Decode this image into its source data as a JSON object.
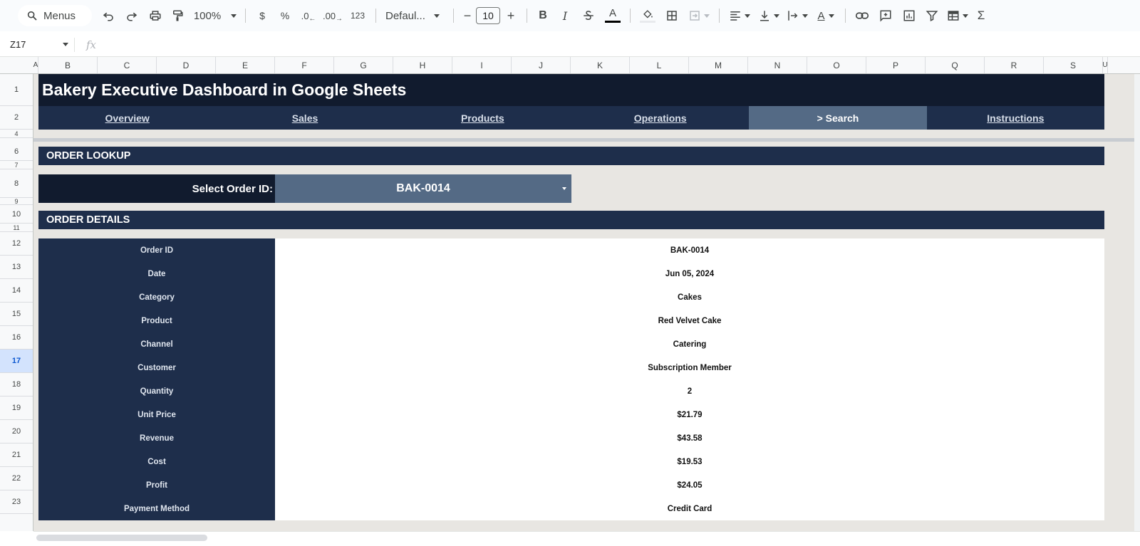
{
  "toolbar": {
    "menus_label": "Menus",
    "zoom": "100%",
    "currency": "$",
    "percent": "%",
    "dec_decrease": ".0",
    "dec_increase": ".00",
    "number_format": "123",
    "font_name": "Defaul...",
    "font_size": "10"
  },
  "formula_bar": {
    "name_box": "Z17",
    "fx": "fx"
  },
  "columns": [
    "A",
    "B",
    "C",
    "D",
    "E",
    "F",
    "G",
    "H",
    "I",
    "J",
    "K",
    "L",
    "M",
    "N",
    "O",
    "P",
    "Q",
    "R",
    "S",
    "U"
  ],
  "rows": [
    "1",
    "2",
    "4",
    "6",
    "7",
    "8",
    "9",
    "10",
    "11",
    "12",
    "13",
    "14",
    "15",
    "16",
    "17",
    "18",
    "19",
    "20",
    "21",
    "22",
    "23"
  ],
  "sheet": {
    "title": "Bakery Executive Dashboard in Google Sheets",
    "nav": [
      "Overview",
      "Sales",
      "Products",
      "Operations",
      "> Search",
      "Instructions"
    ],
    "lookup_section": "ORDER LOOKUP",
    "lookup_label": "Select Order ID:",
    "lookup_value": "BAK-0014",
    "details_section": "ORDER DETAILS",
    "details": [
      {
        "label": "Order ID",
        "value": "BAK-0014"
      },
      {
        "label": "Date",
        "value": "Jun 05, 2024"
      },
      {
        "label": "Category",
        "value": "Cakes"
      },
      {
        "label": "Product",
        "value": "Red Velvet Cake"
      },
      {
        "label": "Channel",
        "value": "Catering"
      },
      {
        "label": "Customer",
        "value": "Subscription Member"
      },
      {
        "label": "Quantity",
        "value": "2"
      },
      {
        "label": "Unit Price",
        "value": "$21.79"
      },
      {
        "label": "Revenue",
        "value": "$43.58"
      },
      {
        "label": "Cost",
        "value": "$19.53"
      },
      {
        "label": "Profit",
        "value": "$24.05"
      },
      {
        "label": "Payment Method",
        "value": "Credit Card"
      }
    ]
  }
}
